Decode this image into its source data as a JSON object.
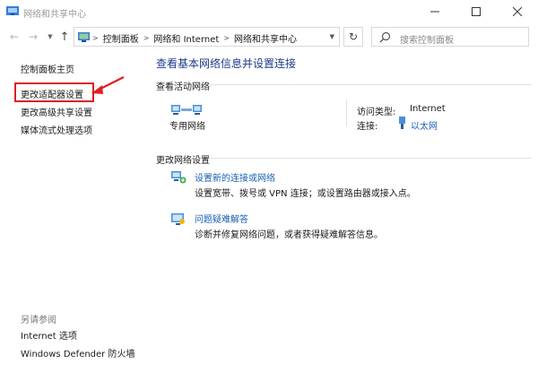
{
  "window": {
    "title": "网络和共享中心",
    "icon": "network-folder-icon",
    "controls": {
      "minimize": "minimize-icon",
      "maximize": "maximize-icon",
      "close": "close-icon"
    }
  },
  "navbar": {
    "breadcrumbs": [
      "控制面板",
      "网络和 Internet",
      "网络和共享中心"
    ],
    "search_placeholder": "搜索控制面板"
  },
  "sidebar": {
    "home": "控制面板主页",
    "links": [
      "更改适配器设置",
      "更改高级共享设置",
      "媒体流式处理选项"
    ],
    "see_also_title": "另请参阅",
    "see_also": [
      "Internet 选项",
      "Windows Defender 防火墙"
    ]
  },
  "main": {
    "title": "查看基本网络信息并设置连接",
    "active_networks_header": "查看活动网络",
    "network": {
      "name": "专用网络",
      "access_type_label": "访问类型:",
      "access_type_value": "Internet",
      "connection_label": "连接:",
      "connection_value": "以太网"
    },
    "change_settings_header": "更改网络设置",
    "tasks": [
      {
        "link": "设置新的连接或网络",
        "desc": "设置宽带、拨号或 VPN 连接；或设置路由器或接入点。"
      },
      {
        "link": "问题疑难解答",
        "desc": "诊断并修复网络问题，或者获得疑难解答信息。"
      }
    ]
  },
  "colors": {
    "annotation": "#e02020",
    "link": "#1a5fb4",
    "title": "#1e3a8a"
  }
}
